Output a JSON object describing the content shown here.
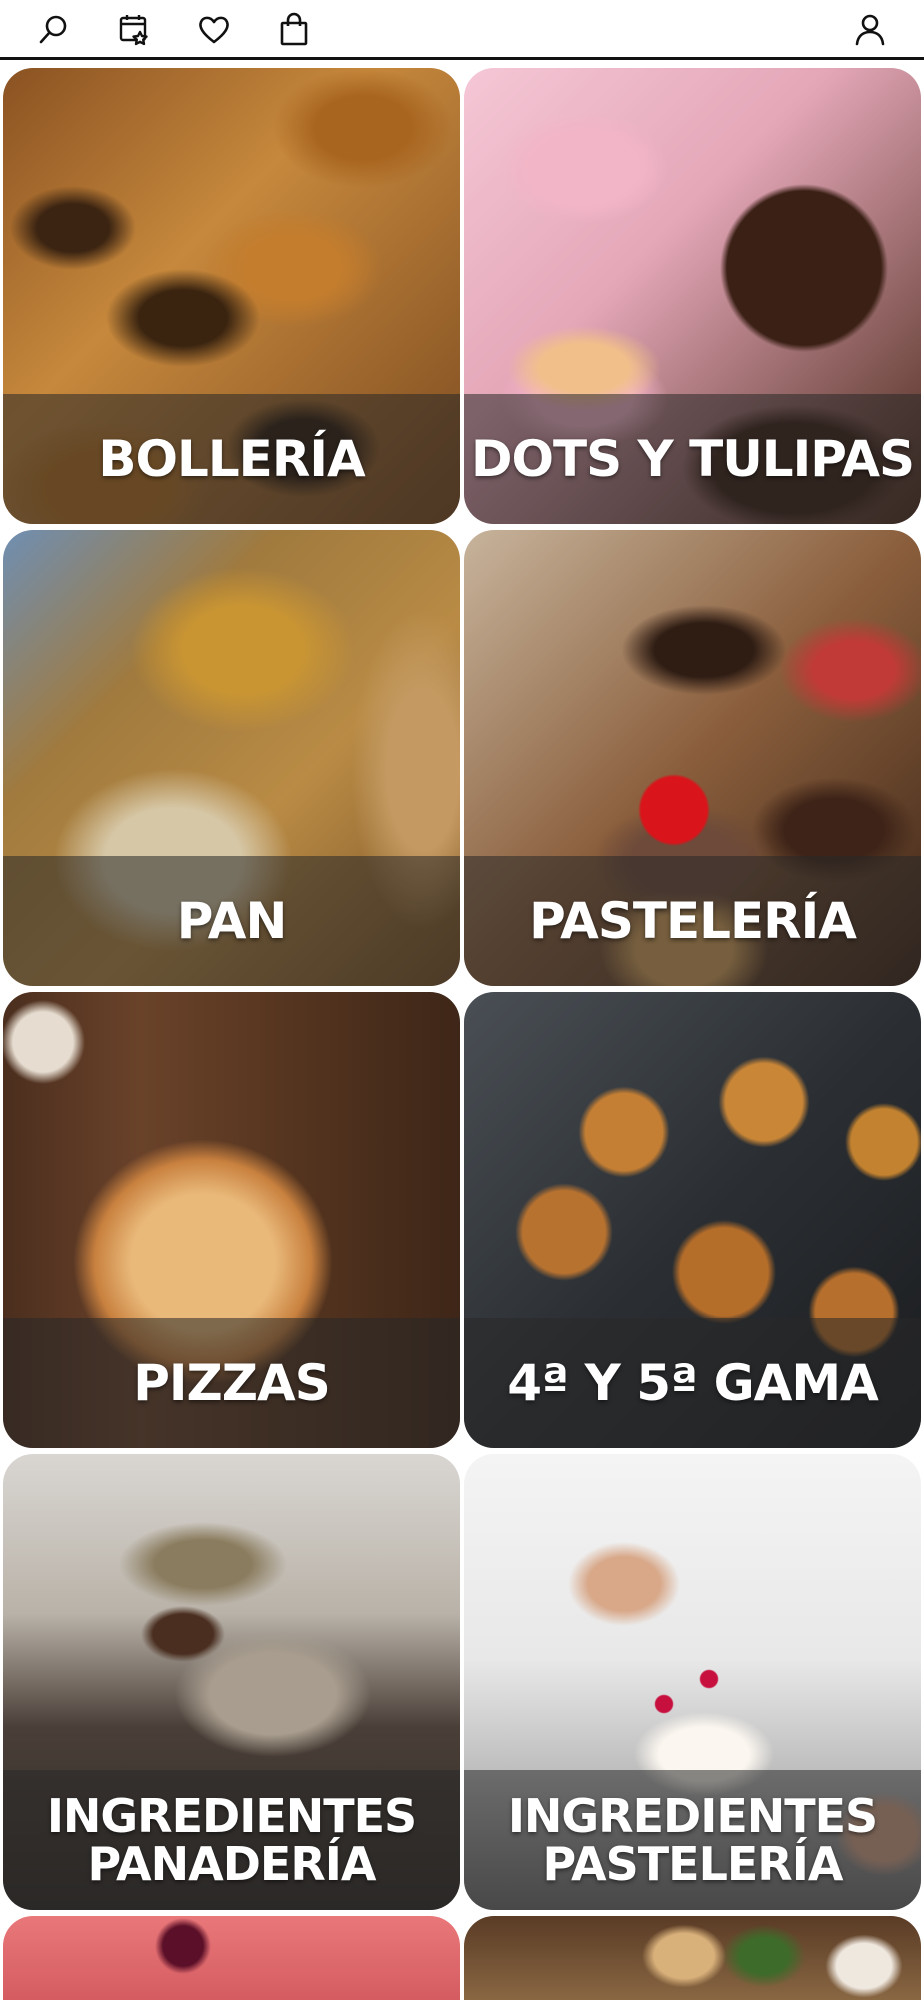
{
  "topbar": {
    "icons": [
      "search-icon",
      "favorites-list-icon",
      "heart-icon",
      "shopping-bag-icon",
      "user-icon"
    ]
  },
  "categories": [
    {
      "line1": "BOLLERÍA",
      "line2": ""
    },
    {
      "line1": "DOTS Y TULIPAS",
      "line2": ""
    },
    {
      "line1": "PAN",
      "line2": ""
    },
    {
      "line1": "PASTELERÍA",
      "line2": ""
    },
    {
      "line1": "PIZZAS",
      "line2": ""
    },
    {
      "line1": "4ª Y 5ª GAMA",
      "line2": ""
    },
    {
      "line1": "INGREDIENTES",
      "line2": "PANADERÍA"
    },
    {
      "line1": "INGREDIENTES",
      "line2": "PASTELERÍA"
    }
  ]
}
